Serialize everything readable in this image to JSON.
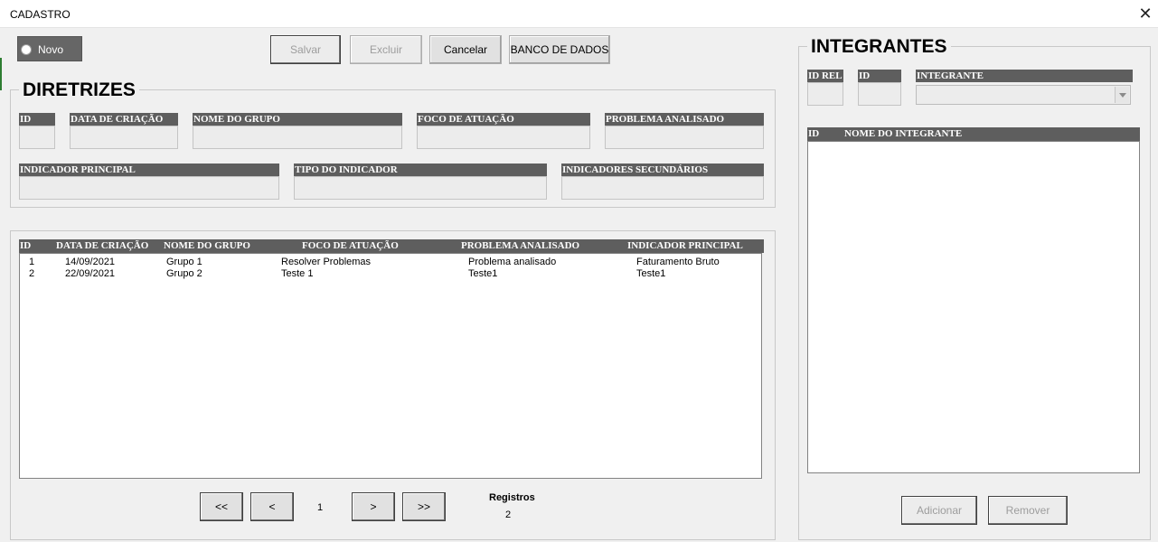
{
  "window": {
    "title": "CADASTRO",
    "close_glyph": "✕"
  },
  "toolbar": {
    "novo_label": "Novo",
    "salvar_label": "Salvar",
    "excluir_label": "Excluir",
    "cancelar_label": "Cancelar",
    "banco_label": "BANCO DE DADOS"
  },
  "diretrizes": {
    "title": "DIRETRIZES",
    "fields": {
      "id": "ID",
      "data_criacao": "DATA DE CRIAÇÃO",
      "nome_grupo": "NOME DO GRUPO",
      "foco_atuacao": "FOCO DE ATUAÇÃO",
      "problema_analisado": "PROBLEMA ANALISADO",
      "indicador_principal": "INDICADOR PRINCIPAL",
      "tipo_indicador": "TIPO DO INDICADOR",
      "indicadores_secundarios": "INDICADORES SECUNDÁRIOS"
    }
  },
  "list": {
    "columns": [
      "ID",
      "DATA DE CRIAÇÃO",
      "NOME DO GRUPO",
      "FOCO DE ATUAÇÃO",
      "PROBLEMA ANALISADO",
      "INDICADOR PRINCIPAL"
    ],
    "rows": [
      [
        "1",
        "14/09/2021",
        "Grupo 1",
        "Resolver Problemas",
        "Problema analisado",
        "Faturamento Bruto"
      ],
      [
        "2",
        "22/09/2021",
        "Grupo 2",
        "Teste 1",
        "Teste1",
        "Teste1"
      ]
    ]
  },
  "nav": {
    "first": "<<",
    "prev": "<",
    "page": "1",
    "next": ">",
    "last": ">>",
    "registros_label": "Registros",
    "registros_count": "2"
  },
  "integrantes": {
    "title": "INTEGRANTES",
    "fields": {
      "id_rel": "ID REL",
      "id": "ID",
      "integrante": "INTEGRANTE"
    },
    "list_columns": [
      "ID",
      "NOME DO INTEGRANTE"
    ],
    "adicionar_label": "Adicionar",
    "remover_label": "Remover"
  }
}
